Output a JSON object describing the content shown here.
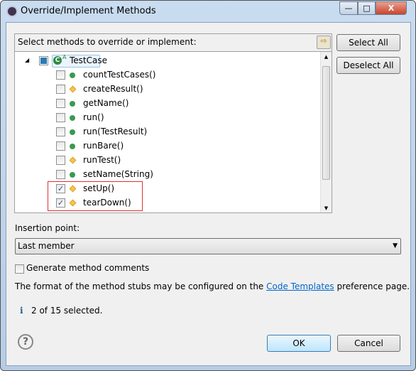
{
  "window": {
    "title": "Override/Implement Methods",
    "minimize": "—",
    "maximize": "□",
    "close": "X"
  },
  "group": {
    "label": "Select methods to override or implement:"
  },
  "tree": {
    "root": "TestCase",
    "items": [
      {
        "label": "countTestCases()",
        "checked": false,
        "icon": "public-method"
      },
      {
        "label": "createResult()",
        "checked": false,
        "icon": "protected-method"
      },
      {
        "label": "getName()",
        "checked": false,
        "icon": "public-method"
      },
      {
        "label": "run()",
        "checked": false,
        "icon": "public-method"
      },
      {
        "label": "run(TestResult)",
        "checked": false,
        "icon": "public-method"
      },
      {
        "label": "runBare()",
        "checked": false,
        "icon": "public-method"
      },
      {
        "label": "runTest()",
        "checked": false,
        "icon": "protected-method"
      },
      {
        "label": "setName(String)",
        "checked": false,
        "icon": "public-method"
      },
      {
        "label": "setUp()",
        "checked": true,
        "icon": "protected-method"
      },
      {
        "label": "tearDown()",
        "checked": true,
        "icon": "protected-method"
      }
    ]
  },
  "buttons": {
    "select_all": "Select All",
    "deselect_all": "Deselect All",
    "ok": "OK",
    "cancel": "Cancel"
  },
  "insertion": {
    "label": "Insertion point:",
    "value": "Last member"
  },
  "generate_comments": {
    "label": "Generate method comments",
    "checked": false
  },
  "info": {
    "prefix": "The format of the method stubs may be configured on the ",
    "link": "Code Templates",
    "suffix": " preference page."
  },
  "status": "2 of 15 selected.",
  "colors": {
    "highlight": "#e03030",
    "link": "#0066cc"
  }
}
